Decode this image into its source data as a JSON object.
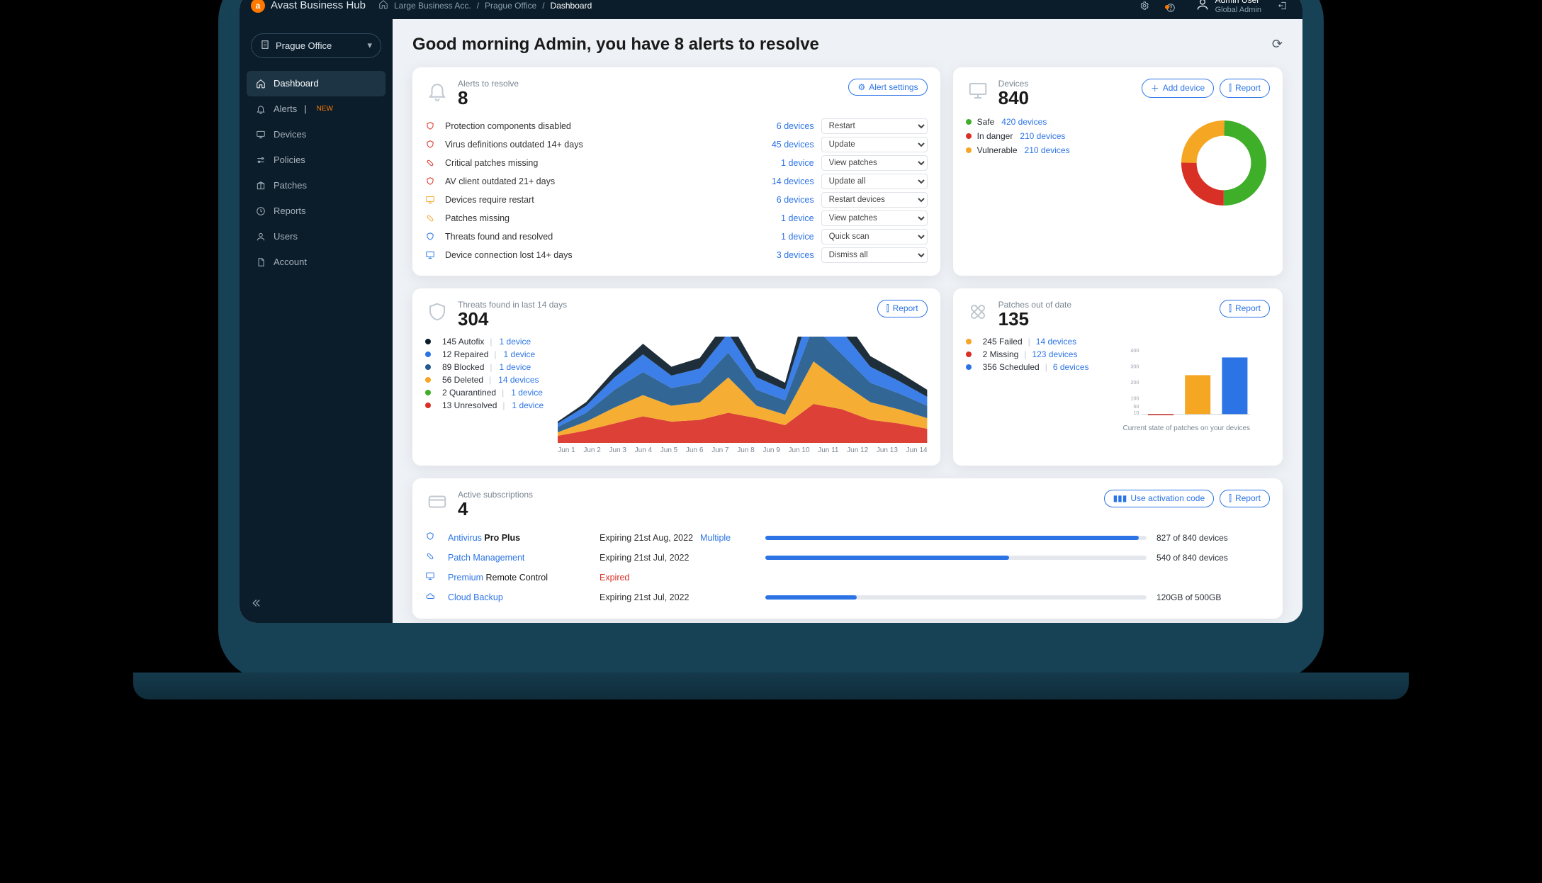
{
  "brand": {
    "name": "Avast Business Hub"
  },
  "breadcrumb": {
    "home_icon": "home",
    "items": [
      "Large Business Acc.",
      "Prague Office"
    ],
    "current": "Dashboard"
  },
  "topbar": {
    "user_name": "Admin User",
    "user_role": "Global Admin"
  },
  "site_selector": {
    "label": "Prague Office"
  },
  "sidebar": {
    "items": [
      {
        "label": "Dashboard",
        "icon": "home",
        "active": true
      },
      {
        "label": "Alerts",
        "icon": "bell",
        "new": "NEW"
      },
      {
        "label": "Devices",
        "icon": "monitor"
      },
      {
        "label": "Policies",
        "icon": "sliders"
      },
      {
        "label": "Patches",
        "icon": "package"
      },
      {
        "label": "Reports",
        "icon": "clock"
      },
      {
        "label": "Users",
        "icon": "user"
      },
      {
        "label": "Account",
        "icon": "file"
      }
    ]
  },
  "greeting": "Good morning Admin, you have 8 alerts to resolve",
  "alerts_card": {
    "title": "Alerts to resolve",
    "count": "8",
    "settings_btn": "Alert settings",
    "rows": [
      {
        "ic": "shield",
        "c": "#d93025",
        "name": "Protection components disabled",
        "devices": "6 devices",
        "action": "Restart"
      },
      {
        "ic": "shield",
        "c": "#d93025",
        "name": "Virus definitions outdated 14+ days",
        "devices": "45 devices",
        "action": "Update"
      },
      {
        "ic": "patch",
        "c": "#d93025",
        "name": "Critical patches missing",
        "devices": "1 device",
        "action": "View patches"
      },
      {
        "ic": "shield",
        "c": "#d93025",
        "name": "AV client outdated 21+ days",
        "devices": "14 devices",
        "action": "Update all"
      },
      {
        "ic": "monitor",
        "c": "#f5a623",
        "name": "Devices require restart",
        "devices": "6 devices",
        "action": "Restart devices"
      },
      {
        "ic": "patch",
        "c": "#f5a623",
        "name": "Patches missing",
        "devices": "1 device",
        "action": "View patches"
      },
      {
        "ic": "shield",
        "c": "#2c74e6",
        "name": "Threats found and resolved",
        "devices": "1 device",
        "action": "Quick scan"
      },
      {
        "ic": "monitor",
        "c": "#2c74e6",
        "name": "Device connection lost 14+ days",
        "devices": "3 devices",
        "action": "Dismiss all"
      }
    ]
  },
  "devices_card": {
    "title": "Devices",
    "count": "840",
    "add_btn": "Add device",
    "report_btn": "Report",
    "legend": [
      {
        "label": "Safe",
        "count": "420 devices",
        "color": "#3fae29"
      },
      {
        "label": "In danger",
        "count": "210 devices",
        "color": "#d93025"
      },
      {
        "label": "Vulnerable",
        "count": "210 devices",
        "color": "#f5a623"
      }
    ]
  },
  "threats_card": {
    "title": "Threats found in last 14 days",
    "count": "304",
    "report_btn": "Report",
    "legend": [
      {
        "n": "145",
        "label": "Autofix",
        "dev": "1 device",
        "color": "#0b1d2a"
      },
      {
        "n": "12",
        "label": "Repaired",
        "dev": "1 device",
        "color": "#2c74e6"
      },
      {
        "n": "89",
        "label": "Blocked",
        "dev": "1 device",
        "color": "#215a8c"
      },
      {
        "n": "56",
        "label": "Deleted",
        "dev": "14 devices",
        "color": "#f5a623"
      },
      {
        "n": "2",
        "label": "Quarantined",
        "dev": "1 device",
        "color": "#3fae29"
      },
      {
        "n": "13",
        "label": "Unresolved",
        "dev": "1 device",
        "color": "#d93025"
      }
    ],
    "xlabels": [
      "Jun 1",
      "Jun 2",
      "Jun 3",
      "Jun 4",
      "Jun 5",
      "Jun 6",
      "Jun 7",
      "Jun 8",
      "Jun 9",
      "Jun 10",
      "Jun 11",
      "Jun 12",
      "Jun 13",
      "Jun 14"
    ]
  },
  "patches_card": {
    "title": "Patches out of date",
    "count": "135",
    "report_btn": "Report",
    "legend": [
      {
        "n": "245",
        "label": "Failed",
        "dev": "14 devices",
        "color": "#f5a623"
      },
      {
        "n": "2",
        "label": "Missing",
        "dev": "123 devices",
        "color": "#d93025"
      },
      {
        "n": "356",
        "label": "Scheduled",
        "dev": "6 devices",
        "color": "#2c74e6"
      }
    ],
    "caption": "Current state of patches on your devices",
    "yticks": [
      "400",
      "300",
      "200",
      "100",
      "50",
      "10"
    ]
  },
  "subs_card": {
    "title": "Active subscriptions",
    "count": "4",
    "code_btn": "Use activation code",
    "report_btn": "Report",
    "rows": [
      {
        "ic": "shield",
        "c": "#2c74e6",
        "name_pre": "Antivirus ",
        "name_b": "Pro Plus",
        "exp": "Expiring 21st Aug, 2022",
        "multi": "Multiple",
        "pct": 98,
        "used": "827 of 840 devices"
      },
      {
        "ic": "patch",
        "c": "#2c74e6",
        "name_pre": "Patch Management",
        "name_b": "",
        "exp": "Expiring 21st Jul, 2022",
        "multi": "",
        "pct": 64,
        "used": "540 of 840 devices"
      },
      {
        "ic": "monitor",
        "c": "#2c74e6",
        "name_pre": "Premium ",
        "name_b": "",
        "name_post": "Remote Control",
        "exp": "Expired",
        "expired": true,
        "multi": "",
        "pct": 0,
        "used": ""
      },
      {
        "ic": "cloud",
        "c": "#2c74e6",
        "name_pre": "Cloud Backup",
        "name_b": "",
        "exp": "Expiring 21st Jul, 2022",
        "multi": "",
        "pct": 24,
        "used": "120GB of 500GB"
      }
    ]
  },
  "chart_data": [
    {
      "type": "pie",
      "title": "Devices",
      "series": [
        {
          "name": "Safe",
          "value": 420,
          "color": "#3fae29"
        },
        {
          "name": "In danger",
          "value": 210,
          "color": "#d93025"
        },
        {
          "name": "Vulnerable",
          "value": 210,
          "color": "#f5a623"
        }
      ]
    },
    {
      "type": "area",
      "title": "Threats found in last 14 days",
      "x": [
        "Jun 1",
        "Jun 2",
        "Jun 3",
        "Jun 4",
        "Jun 5",
        "Jun 6",
        "Jun 7",
        "Jun 8",
        "Jun 9",
        "Jun 10",
        "Jun 11",
        "Jun 12",
        "Jun 13",
        "Jun 14"
      ],
      "series": [
        {
          "name": "Unresolved",
          "color": "#d93025",
          "values": [
            8,
            14,
            22,
            30,
            24,
            26,
            34,
            28,
            20,
            44,
            38,
            26,
            22,
            16
          ]
        },
        {
          "name": "Deleted",
          "color": "#f5a623",
          "values": [
            4,
            10,
            18,
            24,
            18,
            20,
            40,
            14,
            12,
            48,
            30,
            20,
            16,
            12
          ]
        },
        {
          "name": "Blocked",
          "color": "#215a8c",
          "values": [
            6,
            10,
            20,
            26,
            20,
            22,
            28,
            18,
            16,
            40,
            32,
            22,
            18,
            14
          ]
        },
        {
          "name": "Repaired",
          "color": "#2c74e6",
          "values": [
            4,
            8,
            14,
            20,
            14,
            16,
            22,
            14,
            12,
            30,
            26,
            18,
            14,
            10
          ]
        },
        {
          "name": "Autofix",
          "color": "#0b1d2a",
          "values": [
            2,
            4,
            8,
            12,
            10,
            12,
            16,
            10,
            8,
            22,
            18,
            12,
            10,
            8
          ]
        }
      ],
      "ylim": [
        0,
        120
      ]
    },
    {
      "type": "bar",
      "title": "Current state of patches on your devices",
      "categories": [
        "Missing",
        "Failed",
        "Scheduled"
      ],
      "series": [
        {
          "name": "Missing",
          "value": 2,
          "color": "#d93025"
        },
        {
          "name": "Failed",
          "value": 245,
          "color": "#f5a623"
        },
        {
          "name": "Scheduled",
          "value": 356,
          "color": "#2c74e6"
        }
      ],
      "ylim": [
        0,
        400
      ],
      "yticks": [
        10,
        50,
        100,
        200,
        300,
        400
      ]
    }
  ]
}
